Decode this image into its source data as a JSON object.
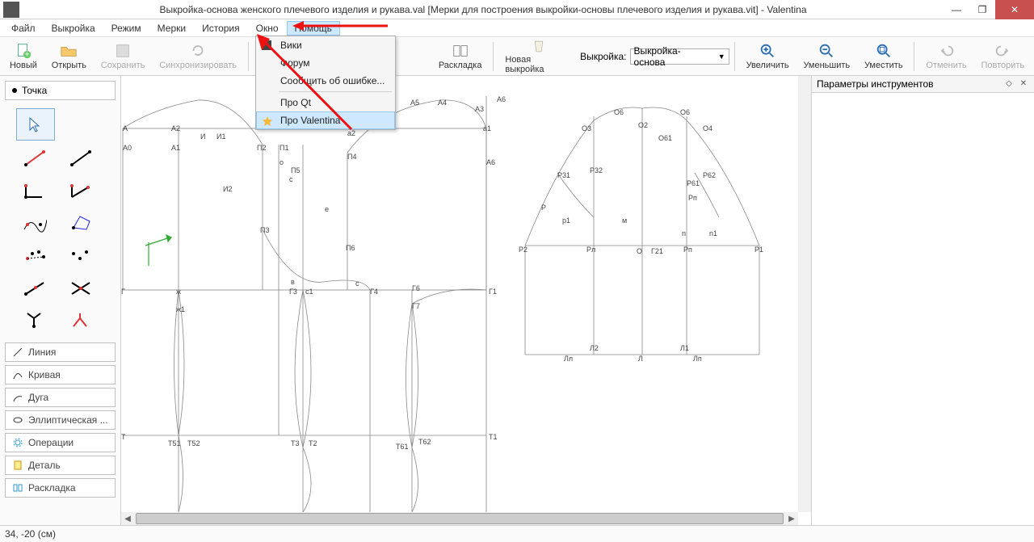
{
  "title": "Выкройка-основа женского плечевого изделия и рукава.val [Мерки для построения выкройки-основы плечевого изделия и рукава.vit] - Valentina",
  "menubar": [
    "Файл",
    "Выкройка",
    "Режим",
    "Мерки",
    "История",
    "Окно",
    "Помощь"
  ],
  "menu_open_index": 6,
  "help_menu": {
    "items": [
      "Вики",
      "Форум",
      "Сообщить об ошибке...",
      "Про Qt",
      "Про Valentina"
    ],
    "highlight_index": 4
  },
  "toolbar": {
    "new": "Новый",
    "open": "Открыть",
    "save": "Сохранить",
    "sync": "Синхронизировать",
    "layout": "Раскладка",
    "new_pattern": "Новая выкройка",
    "pattern_label": "Выкройка:",
    "pattern_value": "Выкройка-основа",
    "zoom_in": "Увеличить",
    "zoom_out": "Уменьшить",
    "fit": "Уместить",
    "undo": "Отменить",
    "redo": "Повторить"
  },
  "left_header": "Точка",
  "left_list": [
    "Линия",
    "Кривая",
    "Дуга",
    "Эллиптическая ...",
    "Операции",
    "Деталь",
    "Раскладка"
  ],
  "right_panel": "Параметры инструментов",
  "status": "34, -20 (см)",
  "canvas_labels": {
    "A": "А",
    "A0": "А0",
    "A1": "А1",
    "A2": "А2",
    "A3": "А3",
    "A4": "А4",
    "A5": "А5",
    "A6": "А6",
    "a1": "а1",
    "a2": "а2",
    "I": "И",
    "I1": "И1",
    "I2": "И2",
    "P1": "П1",
    "P2": "П2",
    "P3": "П3",
    "P4": "П4",
    "P5": "П5",
    "P6": "П6",
    "G": "Г",
    "G1": "Г1",
    "G3": "Г3",
    "G4": "Г4",
    "G6": "Г6",
    "G7": "Г7",
    "zh": "ж",
    "zh1": "ж1",
    "c1": "с1",
    "c": "с",
    "v": "в",
    "e": "е",
    "o": "о",
    "T": "Т",
    "T1": "Т1",
    "T3": "Т3",
    "T2": "Т2",
    "T51": "Т51",
    "T52": "Т52",
    "T61": "Т61",
    "T62": "Т62",
    "O3": "O3",
    "O6a": "O6",
    "O61": "O61",
    "O2": "O2",
    "O6b": "O6",
    "O4": "O4",
    "R31": "Р31",
    "R32": "Р32",
    "R61": "Р61",
    "R62": "Р62",
    "Rp": "Рп",
    "R": "Р",
    "p1": "р1",
    "m": "м",
    "n": "n",
    "n1": "n1",
    "G21": "Г21",
    "Ol": "О",
    "Lc": "Л",
    "Rl": "Рл",
    "R2": "Р2",
    "R1": "Р1",
    "L2": "Л2",
    "Ll": "Лл",
    "L": "Л",
    "L1": "Л1",
    "Lp": "Лп"
  }
}
